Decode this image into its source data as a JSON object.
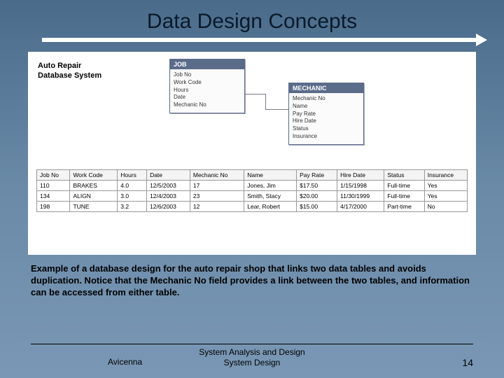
{
  "title": "Data Design Concepts",
  "system_label": "Auto Repair\nDatabase System",
  "entities": {
    "job": {
      "header": "JOB",
      "attrs": [
        "Job No",
        "Work Code",
        "Hours",
        "Date",
        "Mechanic No"
      ]
    },
    "mechanic": {
      "header": "MECHANIC",
      "attrs": [
        "Mechanic No",
        "Name",
        "Pay Rate",
        "Hire Date",
        "Status",
        "Insurance"
      ]
    }
  },
  "table": {
    "headers": [
      "Job No",
      "Work Code",
      "Hours",
      "Date",
      "Mechanic No",
      "Name",
      "Pay Rate",
      "Hire Date",
      "Status",
      "Insurance"
    ],
    "rows": [
      [
        "110",
        "BRAKES",
        "4.0",
        "12/5/2003",
        "17",
        "Jones, Jim",
        "$17.50",
        "1/15/1998",
        "Full-time",
        "Yes"
      ],
      [
        "134",
        "ALIGN",
        "3.0",
        "12/4/2003",
        "23",
        "Smith, Stacy",
        "$20.00",
        "11/30/1999",
        "Full-time",
        "Yes"
      ],
      [
        "198",
        "TUNE",
        "3.2",
        "12/6/2003",
        "12",
        "Lear, Robert",
        "$15.00",
        "4/17/2000",
        "Part-time",
        "No"
      ]
    ]
  },
  "caption": "Example of a database design for the auto repair shop that links two data tables and avoids duplication. Notice that the Mechanic No field provides a link between the two tables, and information can be accessed from either table.",
  "footer": {
    "line1": "System Analysis and Design",
    "line2": "System Design",
    "author": "Avicenna",
    "page": "14"
  }
}
